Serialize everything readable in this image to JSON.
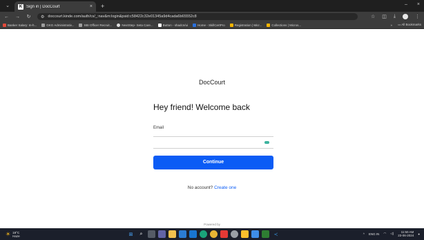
{
  "browser": {
    "tab_title": "Sign in | DocCourt",
    "tab_menu_icon": "chevron-down-icon",
    "tab_close": "×",
    "new_tab": "+",
    "win_minimize": "–",
    "win_close": "×",
    "url": "doccourt.kinde.com/auth/cx/_:nav&m:login&psid:c58422c32e01345a9d4cada6b65552c8",
    "bookmarks": [
      {
        "label": "Banker Salary: In-h...",
        "color": "#e24a3b"
      },
      {
        "label": "GKG Administrativ...",
        "color": "#9e9e9e"
      },
      {
        "label": "SBI Officer Recruit...",
        "color": "#9e9e9e"
      },
      {
        "label": "NextStep- Seta Care...",
        "color": "#dddddd"
      },
      {
        "label": "Button - shadcn/ui",
        "color": "#ffffff"
      },
      {
        "label": "Home - SkillCertPro",
        "color": "#2a6fdb"
      },
      {
        "label": "Registration | Micr...",
        "color": "#f4b400"
      },
      {
        "label": "Collections | Micros...",
        "color": "#f4b400"
      }
    ],
    "bookmarks_overflow": "»",
    "all_bookmarks": "All Bookmarks"
  },
  "page": {
    "brand": "DocCourt",
    "heading": "Hey friend! Welcome back",
    "email_label": "Email",
    "email_value": "",
    "continue_label": "Continue",
    "no_account_text": "No account?",
    "create_one_label": "Create one",
    "powered_by": "Powered by",
    "accent_color": "#0b5cf5"
  },
  "taskbar": {
    "temperature": "19°C",
    "weather_desc": "Haze",
    "language": "ENG IN",
    "time": "11:50 AM",
    "date": "23-06-2024"
  }
}
